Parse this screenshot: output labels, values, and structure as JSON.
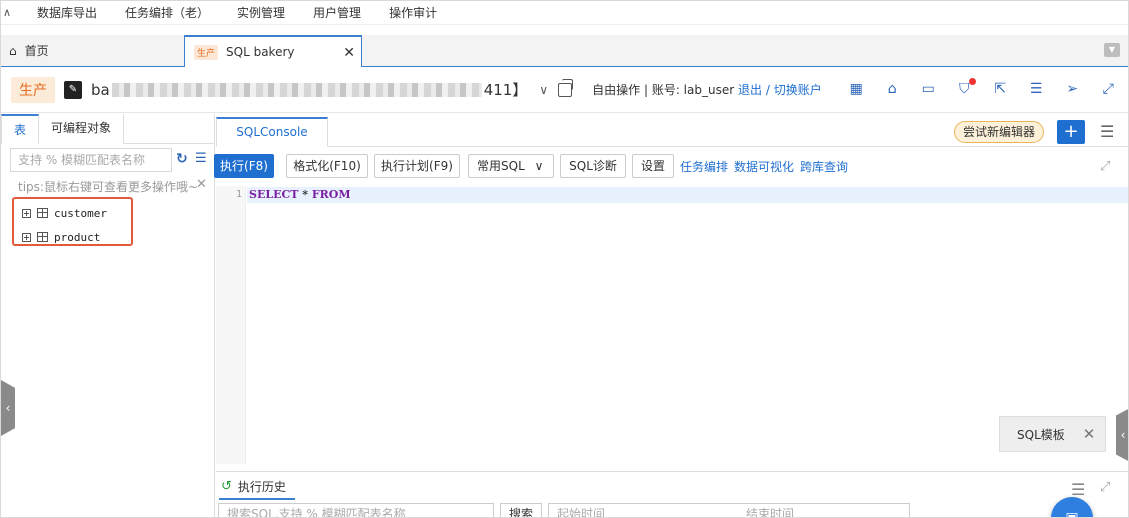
{
  "menu": {
    "items": [
      "数据库导出",
      "任务编排（老）",
      "实例管理",
      "用户管理",
      "操作审计"
    ]
  },
  "tabs": {
    "home": "首页",
    "active_badge": "生产",
    "active_title": "SQL bakery"
  },
  "db": {
    "env": "生产",
    "name_prefix": "ba",
    "name_suffix": "411】",
    "mode": "自由操作 | 账号: lab_user",
    "logout": "退出",
    "slash": " / ",
    "switch": "切换账户"
  },
  "left": {
    "tab_table": "表",
    "tab_prog": "可编程对象",
    "search_placeholder": "支持 % 模糊匹配表名称",
    "tips": "tips:鼠标右键可查看更多操作哦~",
    "tables": [
      "customer",
      "product"
    ]
  },
  "editor": {
    "tab": "SQLConsole",
    "try_new": "尝试新编辑器",
    "toolbar": {
      "run": "执行(F8)",
      "format": "格式化(F10)",
      "plan": "执行计划(F9)",
      "common": "常用SQL",
      "diag": "SQL诊断",
      "settings": "设置",
      "task": "任务编排",
      "visual": "数据可视化",
      "cross": "跨库查询"
    },
    "line_no": "1",
    "code": {
      "kw1": "SELECT",
      "op": " * ",
      "kw2": "FROM"
    },
    "sql_template": "SQL模板"
  },
  "history": {
    "title": "执行历史",
    "search_placeholder": "搜索SQL,支持 % 模糊匹配表名称",
    "search_btn": "搜索",
    "start": "起始时间",
    "end": "结束时间"
  },
  "colors": {
    "accent": "#1f6fd1",
    "env_badge": "#e46c1f",
    "highlight_box": "#e05b3a"
  }
}
